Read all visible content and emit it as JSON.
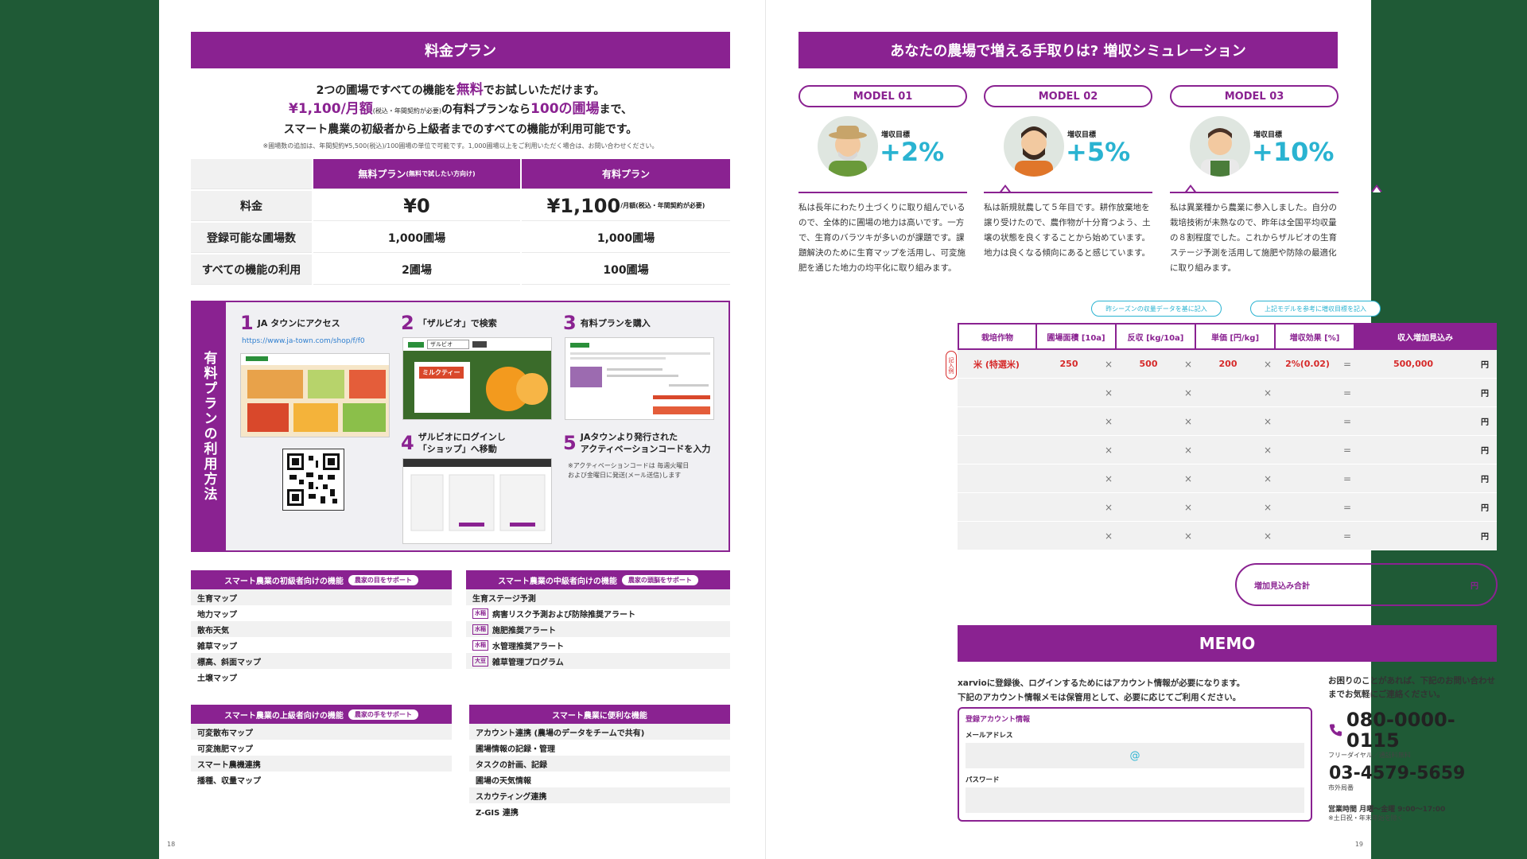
{
  "left": {
    "page_title": "料金プラン",
    "intro": {
      "l1_a": "2つの圃場ですべての機能を",
      "l1_free": "無料",
      "l1_b": "でお試しいただけます。",
      "l2_price": "¥1,100/月額",
      "l2_tax": "(税込・年間契約が必要)",
      "l2_a": "の有料プランなら",
      "l2_fields": "100の圃場",
      "l2_b": "まで、",
      "l3": "スマート農業の初級者から上級者までのすべての機能が利用可能です。",
      "note": "※圃場数の追加は、年間契約¥5,500(税込)/100圃場の単位で可能です。1,000圃場以上をご利用いただく場合は、お問い合わせください。"
    },
    "pricing": {
      "head_free": "無料プラン",
      "head_free_sub": "(無料で試したい方向け)",
      "head_paid": "有料プラン",
      "rows": [
        {
          "label": "料金",
          "free": "¥0",
          "paid": "¥1,100",
          "paid_sub": "/月額(税込・年間契約が必要)"
        },
        {
          "label": "登録可能な圃場数",
          "free": "1,000圃場",
          "paid": "1,000圃場"
        },
        {
          "label": "すべての機能の利用",
          "free": "2圃場",
          "paid": "100圃場"
        }
      ]
    },
    "steps": {
      "side_title": "有料プランの利用方法",
      "s1_num": "1",
      "s1_title": "JA タウンにアクセス",
      "s1_url": "https://www.ja-town.com/shop/f/f0",
      "s2_num": "2",
      "s2_title": "「ザルビオ」で検索",
      "s3_num": "3",
      "s3_title": "有料プランを購入",
      "s4_num": "4",
      "s4_title_1": "ザルビオにログインし",
      "s4_title_2": "「ショップ」へ移動",
      "s5_num": "5",
      "s5_title_1": "JAタウンより発行された",
      "s5_title_2": "アクティベーションコードを入力",
      "s5_note_1": "※アクティベーションコードは 毎週火曜日",
      "s5_note_2": "および金曜日に発送(メール送信)します",
      "shot_search": "ザルビオ",
      "shot_banner": "ミルクティー"
    },
    "features": {
      "beginner": {
        "title": "スマート農業の初級者向けの機能",
        "pill": "農家の目をサポート",
        "items": [
          "生育マップ",
          "地力マップ",
          "散布天気",
          "雑草マップ",
          "標高、斜面マップ",
          "土壌マップ"
        ]
      },
      "intermediate": {
        "title": "スマート農業の中級者向けの機能",
        "pill": "農家の頭脳をサポート",
        "items": [
          {
            "tag": "",
            "text": "生育ステージ予測"
          },
          {
            "tag": "水稲",
            "text": "病害リスク予測および防除推奨アラート"
          },
          {
            "tag": "水稲",
            "text": "施肥推奨アラート"
          },
          {
            "tag": "水稲",
            "text": "水管理推奨アラート"
          },
          {
            "tag": "大豆",
            "text": "雑草管理プログラム"
          }
        ]
      },
      "advanced": {
        "title": "スマート農業の上級者向けの機能",
        "pill": "農家の手をサポート",
        "items": [
          "可変散布マップ",
          "可変施肥マップ",
          "スマート農機連携",
          "播種、収量マップ"
        ]
      },
      "convenient": {
        "title": "スマート農業に便利な機能",
        "items": [
          "アカウント連携 (農場のデータをチームで共有)",
          "圃場情報の記録・管理",
          "タスクの計画、記録",
          "圃場の天気情報",
          "スカウティング連携",
          "Z-GIS 連携"
        ]
      }
    },
    "page_number": "18"
  },
  "right": {
    "page_title": "あなたの農場で増える手取りは? 増収シミュレーション",
    "models": [
      {
        "label": "MODEL 01",
        "goal_label": "増収目標",
        "goal": "+2%",
        "text": "私は長年にわたり土づくりに取り組んでいるので、全体的に圃場の地力は高いです。一方で、生育のバラツキが多いのが課題です。課題解決のために生育マップを活用し、可変施肥を通じた地力の均平化に取り組みます。"
      },
      {
        "label": "MODEL 02",
        "goal_label": "増収目標",
        "goal": "+5%",
        "text": "私は新規就農して５年目です。耕作放棄地を譲り受けたので、農作物が十分育つよう、土壌の状態を良くすることから始めています。地力は良くなる傾向にあると感じています。"
      },
      {
        "label": "MODEL 03",
        "goal_label": "増収目標",
        "goal": "+10%",
        "text": "私は異業種から農業に参入しました。自分の栽培技術が未熟なので、昨年は全国平均収量の８割程度でした。これからザルビオの生育ステージ予測を活用して施肥や防除の最適化に取り組みます。"
      }
    ],
    "callouts": [
      "昨シーズンの収量データを基に記入",
      "上記モデルを参考に増収目標を記入"
    ],
    "sim": {
      "headers": [
        "栽培作物",
        "圃場面積 [10a]",
        "反収 [kg/10a]",
        "単価 [円/kg]",
        "増収効果 [%]",
        "収入増加見込み"
      ],
      "side_badge": "記入例",
      "times": "×",
      "equals": "=",
      "yen": "円",
      "example": {
        "crop": "米 (特選米)",
        "area": "250",
        "yield": "500",
        "price": "200",
        "effect": "2%(0.02)",
        "income": "500,000"
      },
      "empty_rows": 6
    },
    "total": {
      "label": "増加見込み合計",
      "unit": "円"
    },
    "memo": {
      "title": "MEMO",
      "text_1": "xarvioに登録後、ログインするためにはアカウント情報が必要になります。",
      "text_2": "下記のアカウント情報メモは保管用として、必要に応じてご利用ください。",
      "box_title": "登録アカウント情報",
      "email_label": "メールアドレス",
      "email_at": "@",
      "password_label": "パスワード"
    },
    "contact": {
      "text_1": "お困りのことがあれば、下記のお問い合わせ",
      "text_2": "までお気軽にご連絡ください。",
      "tel1": "080-0000-0115",
      "tel1_sub": "フリーダイヤル／通話料無料",
      "tel2": "03-4579-5659",
      "tel2_sub": "市外局番",
      "hours": "営業時間 月曜～金曜 9:00～17:00",
      "hours_note": "※土日祝・年末年始を除く"
    },
    "page_number": "19"
  },
  "colors": {
    "accent": "#8a2291",
    "cyan": "#2ab3d1",
    "background": "#1f5a36",
    "red": "#d62a2a"
  }
}
